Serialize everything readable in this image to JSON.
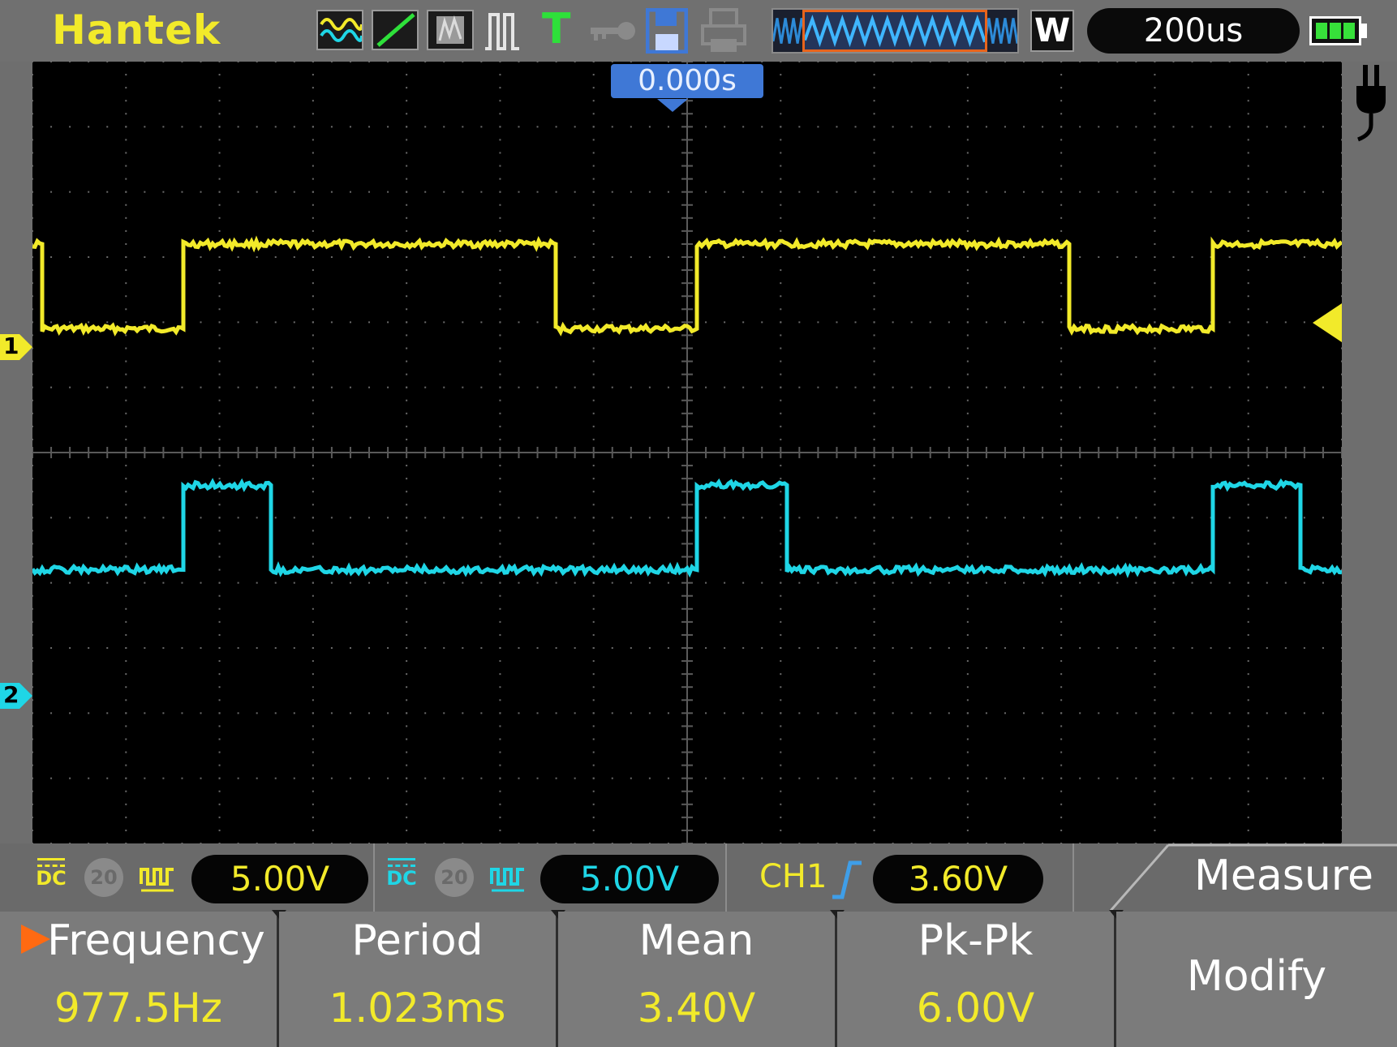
{
  "brand": "Hantek",
  "colors": {
    "ch1": "#f2ea2a",
    "ch2": "#1fd6e6",
    "accent": "#ff6a12",
    "marker": "#3f78d6",
    "grid": "#6a6a6a",
    "battery": "#37e03a"
  },
  "toolbar": {
    "icons": [
      "waveform-mode-icon",
      "xy-mode-icon",
      "persistence-icon",
      "pulse-icon",
      "trigger-t-icon",
      "key-icon",
      "save-icon",
      "print-icon"
    ],
    "trigger_label": "T",
    "window_label": "W",
    "timebase": "200us",
    "battery_level": 1.0
  },
  "screen": {
    "time_offset": "0.000s",
    "ch1_marker": "1",
    "ch2_marker": "2"
  },
  "channels": [
    {
      "coupling": "DC",
      "bw_limit": "20",
      "volts_per_div": "5.00V",
      "color": "#f2ea2a"
    },
    {
      "coupling": "DC",
      "bw_limit": "20",
      "volts_per_div": "5.00V",
      "color": "#1fd6e6"
    }
  ],
  "trigger": {
    "source": "CH1",
    "edge": "rising",
    "level": "3.60V"
  },
  "menu": {
    "title": "Measure",
    "items": [
      {
        "label": "Frequency",
        "value": "977.5Hz",
        "selected": true
      },
      {
        "label": "Period",
        "value": "1.023ms"
      },
      {
        "label": "Mean",
        "value": "3.40V"
      },
      {
        "label": "Pk-Pk",
        "value": "6.00V"
      }
    ],
    "modify_label": "Modify"
  },
  "waveforms": {
    "time_per_div_us": 200,
    "horizontal_divs": 14,
    "ch1": {
      "period_us": 1100,
      "low_start_us": 16,
      "low_end_us": 320,
      "phase_us": 0,
      "high_div": 3.2,
      "low_div": 1.9
    },
    "ch2": {
      "period_us": 1100,
      "high_start_us": 320,
      "high_end_us": 510,
      "phase_us": 0,
      "high_div": -0.5,
      "low_div": -1.8
    }
  }
}
